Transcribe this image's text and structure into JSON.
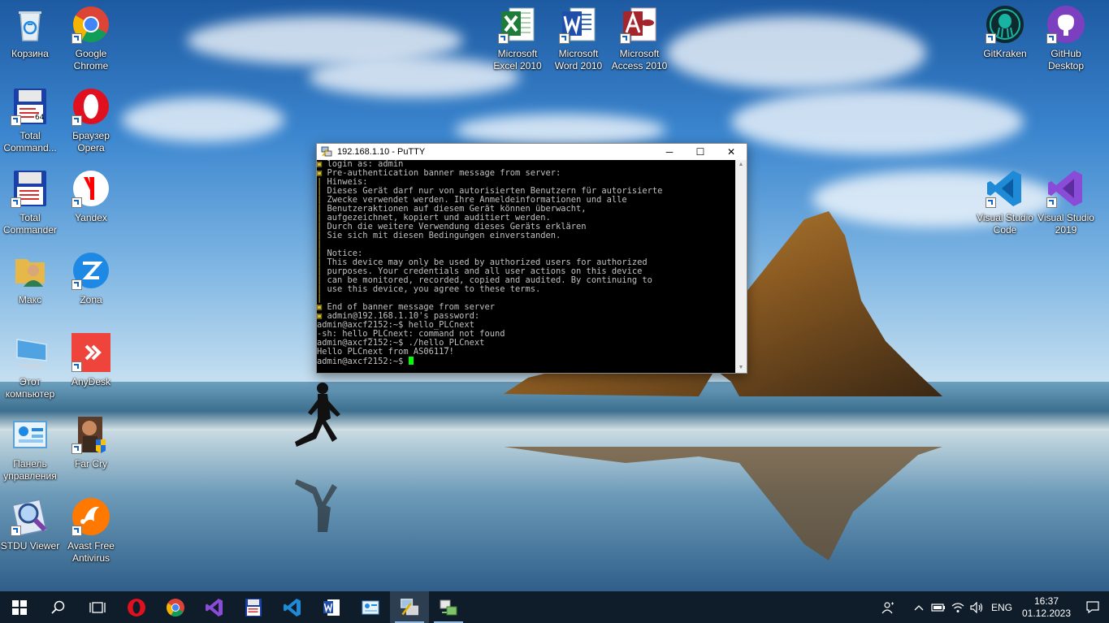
{
  "desktop": {
    "icons": [
      {
        "label": "Корзина",
        "icon": "recycle-bin-icon"
      },
      {
        "label": "Google Chrome",
        "icon": "chrome-icon"
      },
      {
        "label": "Total Command...",
        "icon": "total-commander-64-icon"
      },
      {
        "label": "Браузер Opera",
        "icon": "opera-icon"
      },
      {
        "label": "Total Commander",
        "icon": "total-commander-icon"
      },
      {
        "label": "Yandex",
        "icon": "yandex-icon"
      },
      {
        "label": "Макс",
        "icon": "user-folder-icon"
      },
      {
        "label": "Zona",
        "icon": "zona-icon"
      },
      {
        "label": "Этот компьютер",
        "icon": "this-pc-icon"
      },
      {
        "label": "AnyDesk",
        "icon": "anydesk-icon"
      },
      {
        "label": "Панель управления",
        "icon": "control-panel-icon"
      },
      {
        "label": "Far Cry",
        "icon": "far-cry-icon"
      },
      {
        "label": "STDU Viewer",
        "icon": "stdu-viewer-icon"
      },
      {
        "label": "Avast Free Antivirus",
        "icon": "avast-icon"
      },
      {
        "label": "Microsoft Excel 2010",
        "icon": "excel-icon"
      },
      {
        "label": "Microsoft Word 2010",
        "icon": "word-icon"
      },
      {
        "label": "Microsoft Access 2010",
        "icon": "access-icon"
      },
      {
        "label": "GitKraken",
        "icon": "gitkraken-icon"
      },
      {
        "label": "GitHub Desktop",
        "icon": "github-desktop-icon"
      },
      {
        "label": "Visual Studio Code",
        "icon": "vscode-icon"
      },
      {
        "label": "Visual Studio 2019",
        "icon": "visual-studio-icon"
      }
    ]
  },
  "putty": {
    "title": "192.168.1.10 - PuTTY",
    "controls": {
      "minimize": "─",
      "maximize": "☐",
      "close": "✕"
    },
    "lines": [
      {
        "mark": "▣",
        "text": " login as: admin"
      },
      {
        "mark": "▣",
        "text": " Pre-authentication banner message from server:"
      },
      {
        "mark": "|",
        "text": " Hinweis:"
      },
      {
        "mark": "|",
        "text": " Dieses Gerät darf nur von autorisierten Benutzern für autorisierte"
      },
      {
        "mark": "|",
        "text": " Zwecke verwendet werden. Ihre Anmeldeinformationen und alle"
      },
      {
        "mark": "|",
        "text": " Benutzeraktionen auf diesem Gerät können überwacht,"
      },
      {
        "mark": "|",
        "text": " aufgezeichnet, kopiert und auditiert werden."
      },
      {
        "mark": "|",
        "text": " Durch die weitere Verwendung dieses Geräts erklären"
      },
      {
        "mark": "|",
        "text": " Sie sich mit diesen Bedingungen einverstanden."
      },
      {
        "mark": "|",
        "text": ""
      },
      {
        "mark": "|",
        "text": " Notice:"
      },
      {
        "mark": "|",
        "text": " This device may only be used by authorized users for authorized"
      },
      {
        "mark": "|",
        "text": " purposes. Your credentials and all user actions on this device"
      },
      {
        "mark": "|",
        "text": " can be monitored, recorded, copied and audited. By continuing to"
      },
      {
        "mark": "|",
        "text": " use this device, you agree to these terms."
      },
      {
        "mark": "|",
        "text": ""
      },
      {
        "mark": "▣",
        "text": " End of banner message from server"
      },
      {
        "mark": "▣",
        "text": " admin@192.168.1.10's password:"
      },
      {
        "mark": "",
        "text": "admin@axcf2152:~$ hello_PLCnext"
      },
      {
        "mark": "",
        "text": "-sh: hello_PLCnext: command not found"
      },
      {
        "mark": "",
        "text": "admin@axcf2152:~$ ./hello_PLCnext"
      },
      {
        "mark": "",
        "text": "Hello PLCnext from AS06117!"
      },
      {
        "mark": "",
        "text": "admin@axcf2152:~$ "
      }
    ]
  },
  "taskbar": {
    "items": [
      {
        "name": "start-button",
        "icon": "windows-icon"
      },
      {
        "name": "search-button",
        "icon": "search-icon"
      },
      {
        "name": "task-view-button",
        "icon": "task-view-icon"
      },
      {
        "name": "taskbar-opera",
        "icon": "opera-icon"
      },
      {
        "name": "taskbar-chrome",
        "icon": "chrome-icon"
      },
      {
        "name": "taskbar-visual-studio",
        "icon": "visual-studio-icon"
      },
      {
        "name": "taskbar-total-commander",
        "icon": "floppy-icon"
      },
      {
        "name": "taskbar-vscode",
        "icon": "vscode-icon"
      },
      {
        "name": "taskbar-word",
        "icon": "word-icon"
      },
      {
        "name": "taskbar-control-panel",
        "icon": "control-panel-icon"
      },
      {
        "name": "taskbar-putty",
        "icon": "putty-icon"
      },
      {
        "name": "taskbar-network-tool",
        "icon": "network-tool-icon"
      }
    ],
    "language": "ENG",
    "time": "16:37",
    "date": "01.12.2023"
  },
  "colors": {
    "taskbar": "#0f1d2b",
    "terminal_bg": "#000000",
    "terminal_text": "#c0c0c0",
    "cursor": "#00ff00"
  }
}
